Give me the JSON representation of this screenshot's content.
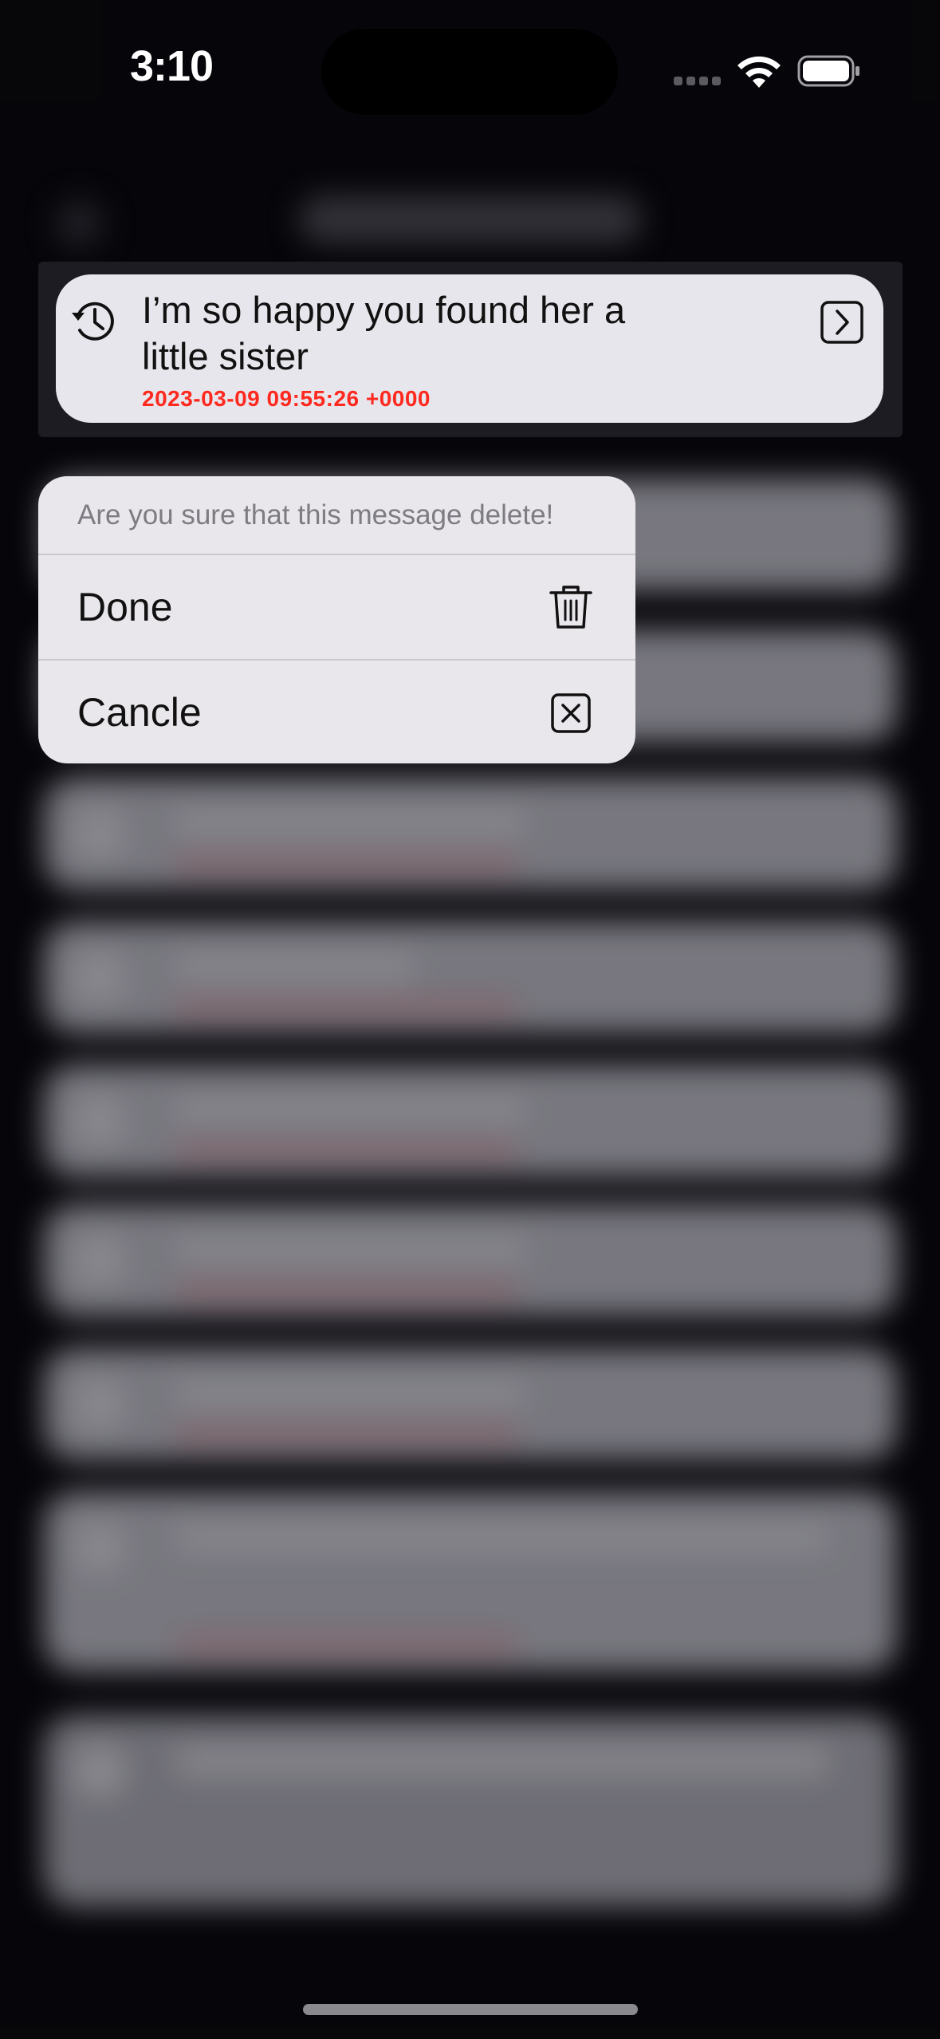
{
  "status_bar": {
    "time": "3:10",
    "wifi_icon": "wifi-icon",
    "battery_icon": "battery-icon",
    "signal_icon": "cellular-signal-icon"
  },
  "message_card": {
    "text": "I’m so happy you found her a little sister",
    "timestamp": "2023-03-09 09:55:26 +0000",
    "leading_icon": "history-icon",
    "trailing_icon": "chevron-right-square-icon",
    "timestamp_color": "#ff2a1f"
  },
  "context_menu": {
    "prompt": "Are you sure that this message delete!",
    "actions": [
      {
        "label": "Done",
        "icon": "trash-icon"
      },
      {
        "label": "Cancle",
        "icon": "xmark-square-icon"
      }
    ]
  }
}
